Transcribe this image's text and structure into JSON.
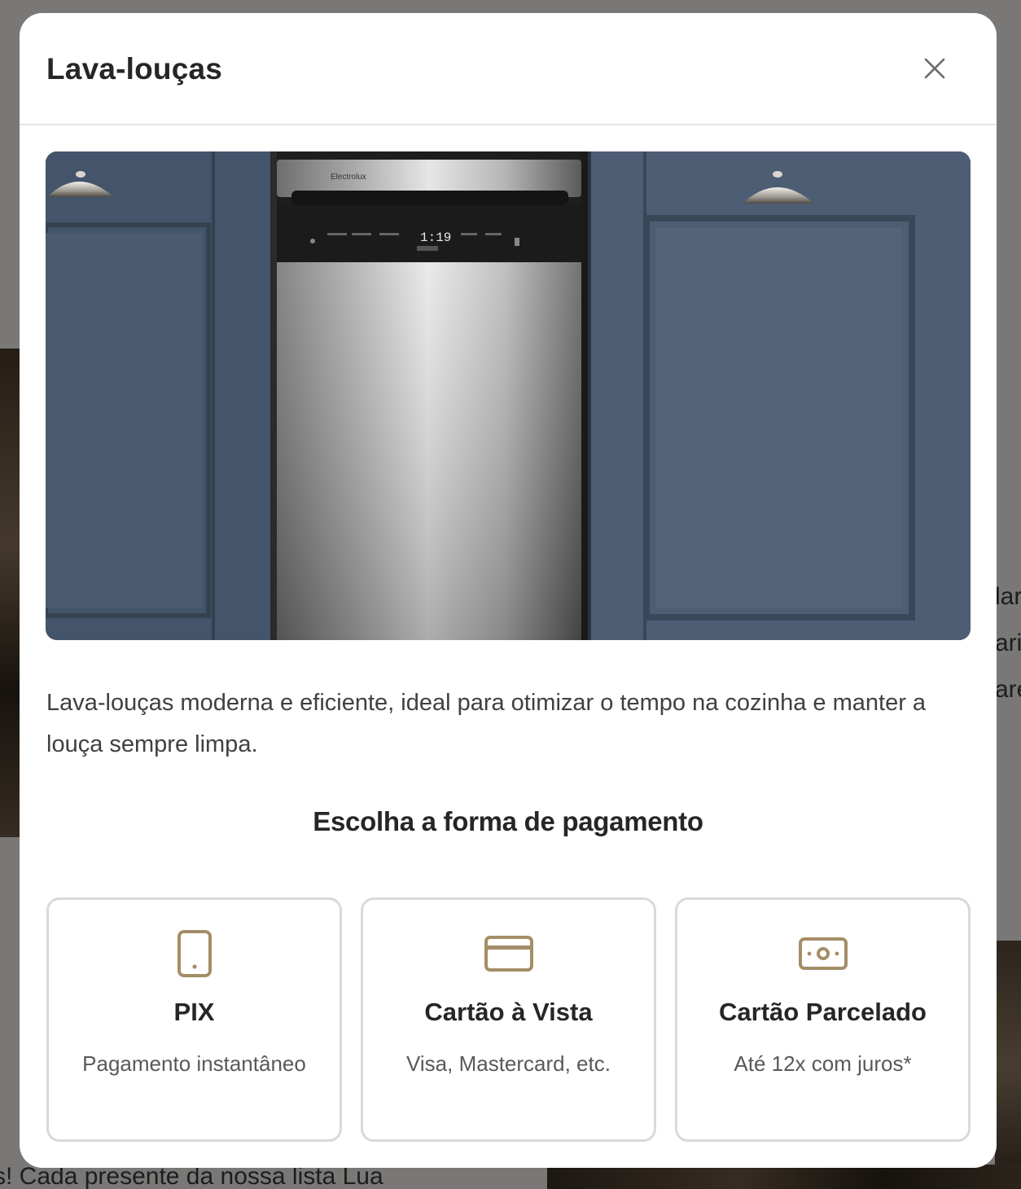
{
  "background": {
    "right_fragments": [
      "lar",
      "ari",
      "are"
    ],
    "bottom_fragment": "s! Cada presente da nossa lista Lua"
  },
  "modal": {
    "title": "Lava-louças",
    "close_icon": "close-icon",
    "image_alt": "Lava-louças Electrolux inox entre armários azuis",
    "brand_on_product": "Electrolux",
    "display_reading": "1:19",
    "description": "Lava-louças moderna e eficiente, ideal para otimizar o tempo na cozinha e manter a louça sempre limpa.",
    "payment_heading": "Escolha a forma de pagamento",
    "payment_options": [
      {
        "icon": "phone-icon",
        "title": "PIX",
        "subtitle": "Pagamento instantâneo"
      },
      {
        "icon": "credit-card-icon",
        "title": "Cartão à Vista",
        "subtitle": "Visa, Mastercard, etc."
      },
      {
        "icon": "cash-icon",
        "title": "Cartão Parcelado",
        "subtitle": "Até 12x com juros*"
      }
    ]
  },
  "colors": {
    "accent_icon": "#A48E67",
    "overlay": "rgba(0,0,0,0.5)",
    "cabinet_blue": "#4C5C72"
  }
}
